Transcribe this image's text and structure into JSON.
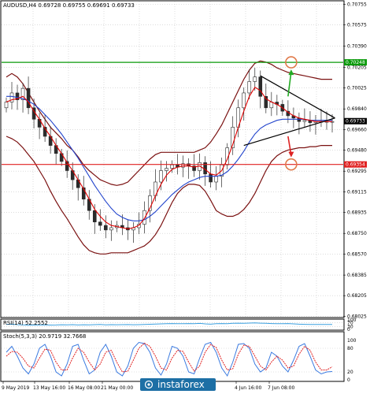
{
  "header": {
    "main_title": "AUDUSD,H4 0.69728 0.69755 0.69691 0.69733",
    "rsi_title": "RSI(14) 52.2552",
    "stoch_title": "Stoch(5,3,3) 20.9719 32.7668"
  },
  "watermark": {
    "text": "instaforex"
  },
  "colors": {
    "background": "#ffffff",
    "candle": "#2b2b2b",
    "bollinger": "#7a1010",
    "ma_fast": "#e00000",
    "ma_slow": "#2244cc",
    "resistance_line": "#0a9a0a",
    "support_line": "#e02020",
    "arrow_up": "#22aa22",
    "arrow_down": "#dd2222",
    "target_circle": "#e07a4a",
    "rsi_line": "#3aa0e0",
    "stoch_main": "#3a7ae0",
    "stoch_signal": "#e02020",
    "price_label": "#000000"
  },
  "chart_data": [
    {
      "type": "candlestick",
      "title": "AUDUSD,H4 0.69728 0.69755 0.69691 0.69733",
      "ylim": [
        0.6802,
        0.7078
      ],
      "y_ticks": [
        "0.70755",
        "0.70575",
        "0.70390",
        "0.70205",
        "0.70025",
        "0.69840",
        "0.69660",
        "0.69480",
        "0.69295",
        "0.69115",
        "0.68935",
        "0.68750",
        "0.68570",
        "0.68385",
        "0.68205",
        "0.68025"
      ],
      "x_ticks": [
        "9 May 2019",
        "13 May 16:00",
        "16 May 08:00",
        "21 May 00:00",
        "4 Jun 16:00",
        "7 Jun 08:00"
      ],
      "bar_count": 60,
      "close": [
        0.699,
        0.6998,
        0.6992,
        0.7002,
        0.6985,
        0.6975,
        0.6968,
        0.696,
        0.6952,
        0.6945,
        0.6938,
        0.693,
        0.6922,
        0.6915,
        0.6905,
        0.6895,
        0.6885,
        0.6882,
        0.6878,
        0.688,
        0.6882,
        0.688,
        0.6878,
        0.688,
        0.6883,
        0.6895,
        0.6908,
        0.692,
        0.693,
        0.6932,
        0.6935,
        0.6933,
        0.6936,
        0.6934,
        0.693,
        0.6937,
        0.6927,
        0.692,
        0.6925,
        0.6935,
        0.695,
        0.6968,
        0.6985,
        0.6998,
        0.7008,
        0.7012,
        0.6995,
        0.6985,
        0.699,
        0.6988,
        0.6982,
        0.6978,
        0.6976,
        0.6973,
        0.6974,
        0.6972,
        0.6973,
        0.6973,
        0.6973,
        0.6973
      ],
      "high_offset": 0.0008,
      "low_offset": 0.0008,
      "bollinger_upper": [
        0.7012,
        0.7015,
        0.7012,
        0.7006,
        0.6998,
        0.699,
        0.6982,
        0.6975,
        0.6968,
        0.6963,
        0.6958,
        0.6952,
        0.6948,
        0.6942,
        0.6935,
        0.693,
        0.6926,
        0.6922,
        0.692,
        0.6918,
        0.6917,
        0.6918,
        0.692,
        0.6925,
        0.693,
        0.6935,
        0.694,
        0.6944,
        0.6946,
        0.6946,
        0.6946,
        0.6946,
        0.6946,
        0.6946,
        0.6946,
        0.6948,
        0.695,
        0.6955,
        0.6962,
        0.697,
        0.698,
        0.699,
        0.7,
        0.701,
        0.7018,
        0.7024,
        0.7026,
        0.7025,
        0.7023,
        0.702,
        0.7018,
        0.7016,
        0.7015,
        0.7014,
        0.7013,
        0.7012,
        0.7011,
        0.701,
        0.701,
        0.701
      ],
      "bollinger_lower": [
        0.696,
        0.6958,
        0.6955,
        0.695,
        0.6944,
        0.6938,
        0.693,
        0.6922,
        0.6912,
        0.6903,
        0.6895,
        0.6888,
        0.688,
        0.6872,
        0.6865,
        0.686,
        0.6858,
        0.6857,
        0.6857,
        0.6858,
        0.6858,
        0.6858,
        0.6858,
        0.686,
        0.6862,
        0.6864,
        0.6868,
        0.6874,
        0.6882,
        0.6892,
        0.6902,
        0.691,
        0.6915,
        0.6918,
        0.6918,
        0.6917,
        0.6912,
        0.6904,
        0.6895,
        0.6892,
        0.689,
        0.689,
        0.6892,
        0.6896,
        0.6902,
        0.691,
        0.692,
        0.693,
        0.6938,
        0.6943,
        0.6946,
        0.6948,
        0.6949,
        0.695,
        0.695,
        0.6951,
        0.6951,
        0.6952,
        0.6952,
        0.6952
      ],
      "ma_fast": [
        0.699,
        0.6992,
        0.6993,
        0.6995,
        0.699,
        0.6982,
        0.6975,
        0.6967,
        0.696,
        0.6952,
        0.6945,
        0.6937,
        0.693,
        0.6922,
        0.6914,
        0.6905,
        0.6896,
        0.689,
        0.6885,
        0.6882,
        0.6881,
        0.688,
        0.6879,
        0.688,
        0.6882,
        0.6888,
        0.6897,
        0.6908,
        0.6918,
        0.6926,
        0.6931,
        0.6933,
        0.6934,
        0.6934,
        0.6933,
        0.6934,
        0.6931,
        0.6927,
        0.6926,
        0.693,
        0.694,
        0.6953,
        0.6968,
        0.6982,
        0.6995,
        0.7003,
        0.7,
        0.6993,
        0.699,
        0.6988,
        0.6985,
        0.6981,
        0.6978,
        0.6976,
        0.6975,
        0.6974,
        0.6973,
        0.6973,
        0.6973,
        0.6973
      ],
      "ma_slow": [
        0.6995,
        0.6995,
        0.6994,
        0.6993,
        0.6991,
        0.6988,
        0.6984,
        0.6979,
        0.6974,
        0.6968,
        0.6962,
        0.6955,
        0.6948,
        0.6941,
        0.6933,
        0.6925,
        0.6917,
        0.691,
        0.6903,
        0.6897,
        0.6892,
        0.6889,
        0.6887,
        0.6886,
        0.6886,
        0.6887,
        0.689,
        0.6894,
        0.6899,
        0.6904,
        0.6909,
        0.6913,
        0.6917,
        0.692,
        0.6922,
        0.6924,
        0.6925,
        0.6925,
        0.6925,
        0.6926,
        0.6929,
        0.6934,
        0.694,
        0.6947,
        0.6955,
        0.6962,
        0.6967,
        0.697,
        0.6972,
        0.6974,
        0.6975,
        0.6975,
        0.6975,
        0.6975,
        0.6975,
        0.6974,
        0.6974,
        0.6974,
        0.6974,
        0.6974
      ],
      "levels": [
        {
          "name": "resistance",
          "value": 0.70248,
          "label": "0.70248"
        },
        {
          "name": "support",
          "value": 0.69354,
          "label": "0.69354"
        }
      ],
      "current_price": {
        "value": 0.69733,
        "label": "0.69733"
      },
      "triangle": {
        "apex_x_index": 59.5,
        "apex_y": 0.6976,
        "upper_start_index": 46,
        "upper_start_y": 0.7013,
        "lower_start_index": 43,
        "lower_start_y": 0.6952
      },
      "projection": {
        "up_target": 0.70248,
        "down_target": 0.69354,
        "from_index": 51,
        "up_start_y": 0.6995,
        "down_start_y": 0.696
      }
    },
    {
      "type": "line",
      "title": "RSI(14) 52.2552",
      "ylim": [
        0,
        100
      ],
      "y_ticks": [
        "100",
        "70",
        "30",
        "0"
      ],
      "values": [
        52,
        55,
        50,
        48,
        45,
        46,
        47,
        48,
        46,
        47,
        49,
        48,
        50,
        47,
        49,
        48,
        50,
        52,
        48,
        50,
        49,
        50,
        51,
        49,
        50,
        52,
        54,
        56,
        58,
        60,
        62,
        60,
        61,
        62,
        60,
        63,
        58,
        55,
        60,
        62,
        61,
        64,
        66,
        65,
        67,
        68,
        66,
        64,
        62,
        60,
        61,
        62,
        58,
        55,
        53,
        52,
        52,
        52,
        52,
        52
      ]
    },
    {
      "type": "line",
      "title": "Stoch(5,3,3) 20.9719 32.7668",
      "ylim": [
        0,
        100
      ],
      "y_ticks": [
        "100",
        "80",
        "20",
        "0"
      ],
      "series": [
        {
          "values": [
            70,
            85,
            60,
            30,
            15,
            40,
            80,
            90,
            60,
            20,
            10,
            40,
            85,
            90,
            50,
            15,
            25,
            70,
            90,
            60,
            20,
            10,
            35,
            80,
            95,
            92,
            70,
            30,
            12,
            40,
            85,
            80,
            60,
            20,
            15,
            55,
            90,
            95,
            70,
            30,
            10,
            45,
            90,
            92,
            80,
            40,
            20,
            30,
            70,
            60,
            35,
            20,
            50,
            85,
            92,
            60,
            25,
            15,
            20,
            21
          ]
        },
        {
          "values": [
            60,
            72,
            70,
            55,
            35,
            30,
            55,
            78,
            75,
            45,
            25,
            25,
            55,
            80,
            70,
            45,
            25,
            40,
            70,
            75,
            45,
            20,
            22,
            50,
            80,
            93,
            85,
            60,
            30,
            25,
            55,
            75,
            72,
            45,
            22,
            35,
            70,
            90,
            82,
            50,
            25,
            28,
            65,
            88,
            85,
            60,
            35,
            25,
            45,
            60,
            50,
            30,
            35,
            65,
            85,
            75,
            45,
            25,
            25,
            33
          ]
        }
      ]
    }
  ]
}
